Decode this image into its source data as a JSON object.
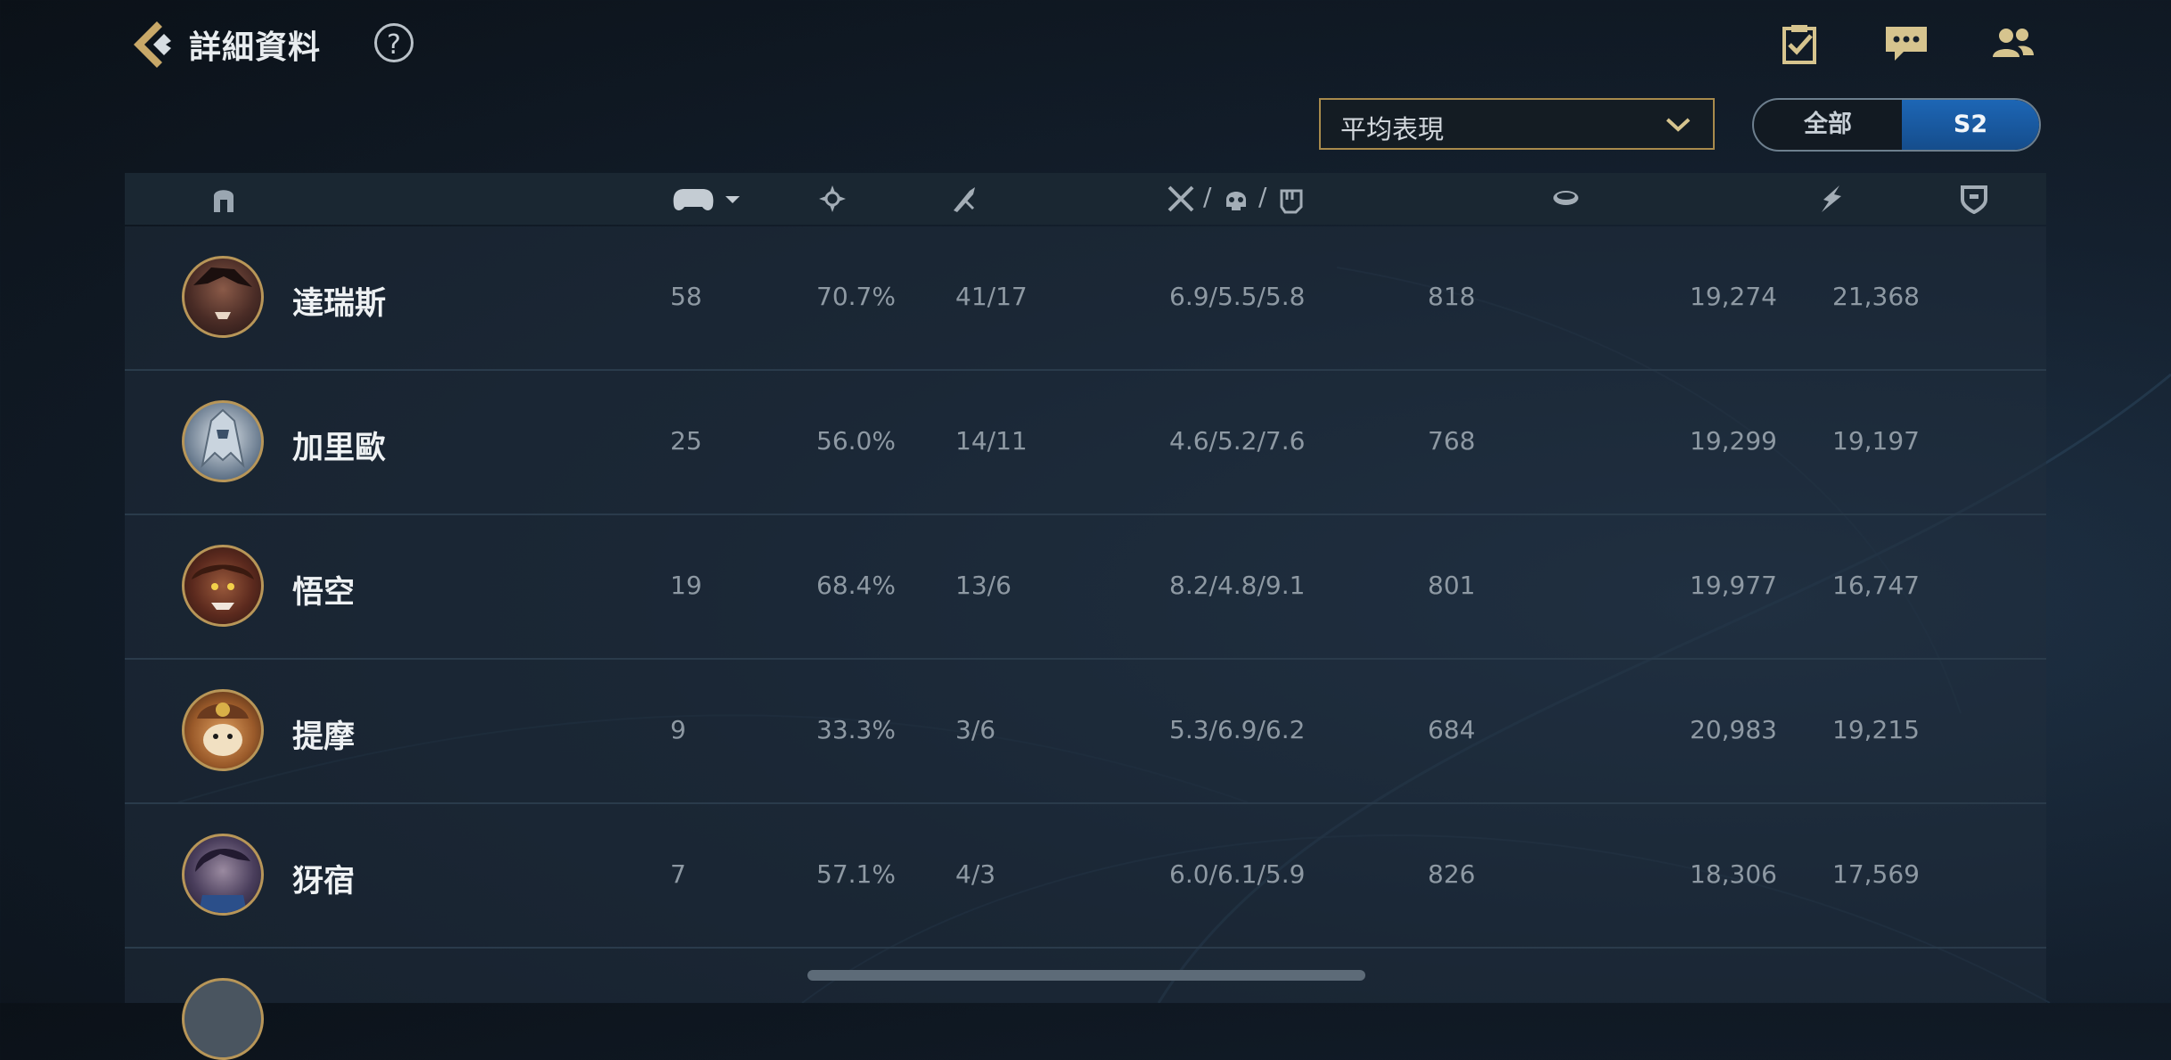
{
  "header": {
    "title": "詳細資料",
    "help_label": "?"
  },
  "top_icons": [
    "checklist-icon",
    "chat-icon",
    "friends-icon"
  ],
  "filter": {
    "dropdown_value": "平均表現",
    "season_options": [
      "全部",
      "S2"
    ],
    "season_selected": "S2"
  },
  "table": {
    "columns": [
      "hero-helmet-icon",
      "gamepad-icon",
      "winrate-icon",
      "mvp-icon",
      "kda-icon",
      "gold-icon",
      "damage-icon",
      "tank-icon"
    ],
    "kda_separators": [
      "/",
      "/"
    ],
    "rows": [
      {
        "name": "達瑞斯",
        "games": "58",
        "winrate": "70.7%",
        "mvp": "41/17",
        "kda": "6.9/5.5/5.8",
        "gold": "818",
        "damage": "19,274",
        "taken": "21,368"
      },
      {
        "name": "加里歐",
        "games": "25",
        "winrate": "56.0%",
        "mvp": "14/11",
        "kda": "4.6/5.2/7.6",
        "gold": "768",
        "damage": "19,299",
        "taken": "19,197"
      },
      {
        "name": "悟空",
        "games": "19",
        "winrate": "68.4%",
        "mvp": "13/6",
        "kda": "8.2/4.8/9.1",
        "gold": "801",
        "damage": "19,977",
        "taken": "16,747"
      },
      {
        "name": "提摩",
        "games": "9",
        "winrate": "33.3%",
        "mvp": "3/6",
        "kda": "5.3/6.9/6.2",
        "gold": "684",
        "damage": "20,983",
        "taken": "19,215"
      },
      {
        "name": "犽宿",
        "games": "7",
        "winrate": "57.1%",
        "mvp": "4/3",
        "kda": "6.0/6.1/5.9",
        "gold": "826",
        "damage": "18,306",
        "taken": "17,569"
      }
    ]
  },
  "colors": {
    "accent_blue": "#1d66b5",
    "gold_border": "#a88a4c"
  }
}
